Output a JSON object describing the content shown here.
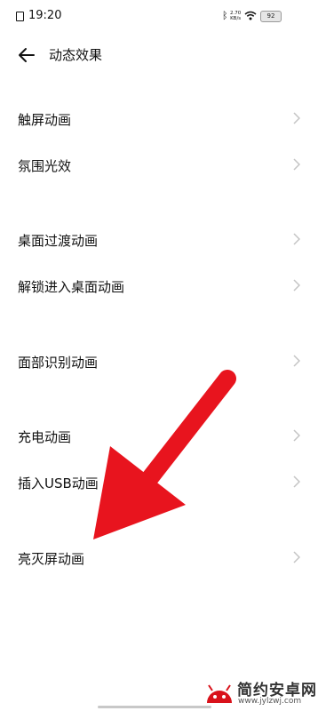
{
  "status_bar": {
    "time": "19:20",
    "network_speed_value": "2.70",
    "network_speed_unit": "KB/s",
    "battery_level": "92",
    "icons": [
      "sim-icon",
      "bluetooth-icon",
      "wifi-icon",
      "battery-icon"
    ]
  },
  "header": {
    "title": "动态效果",
    "back_icon": "back-arrow-icon"
  },
  "settings": {
    "groups": [
      {
        "items": [
          {
            "label": "触屏动画"
          },
          {
            "label": "氛围光效"
          }
        ]
      },
      {
        "items": [
          {
            "label": "桌面过渡动画"
          },
          {
            "label": "解锁进入桌面动画"
          }
        ]
      },
      {
        "items": [
          {
            "label": "面部识别动画"
          }
        ]
      },
      {
        "items": [
          {
            "label": "充电动画"
          },
          {
            "label": "插入USB动画"
          }
        ]
      },
      {
        "items": [
          {
            "label": "亮灭屏动画"
          }
        ]
      }
    ],
    "row_icon": "chevron-right-icon"
  },
  "annotation": {
    "arrow_color": "#e8141e",
    "points_to": "亮灭屏动画"
  },
  "watermark": {
    "title": "简约安卓网",
    "subtitle": "www.jylzwj.com",
    "logo_color": "#d9121b"
  }
}
